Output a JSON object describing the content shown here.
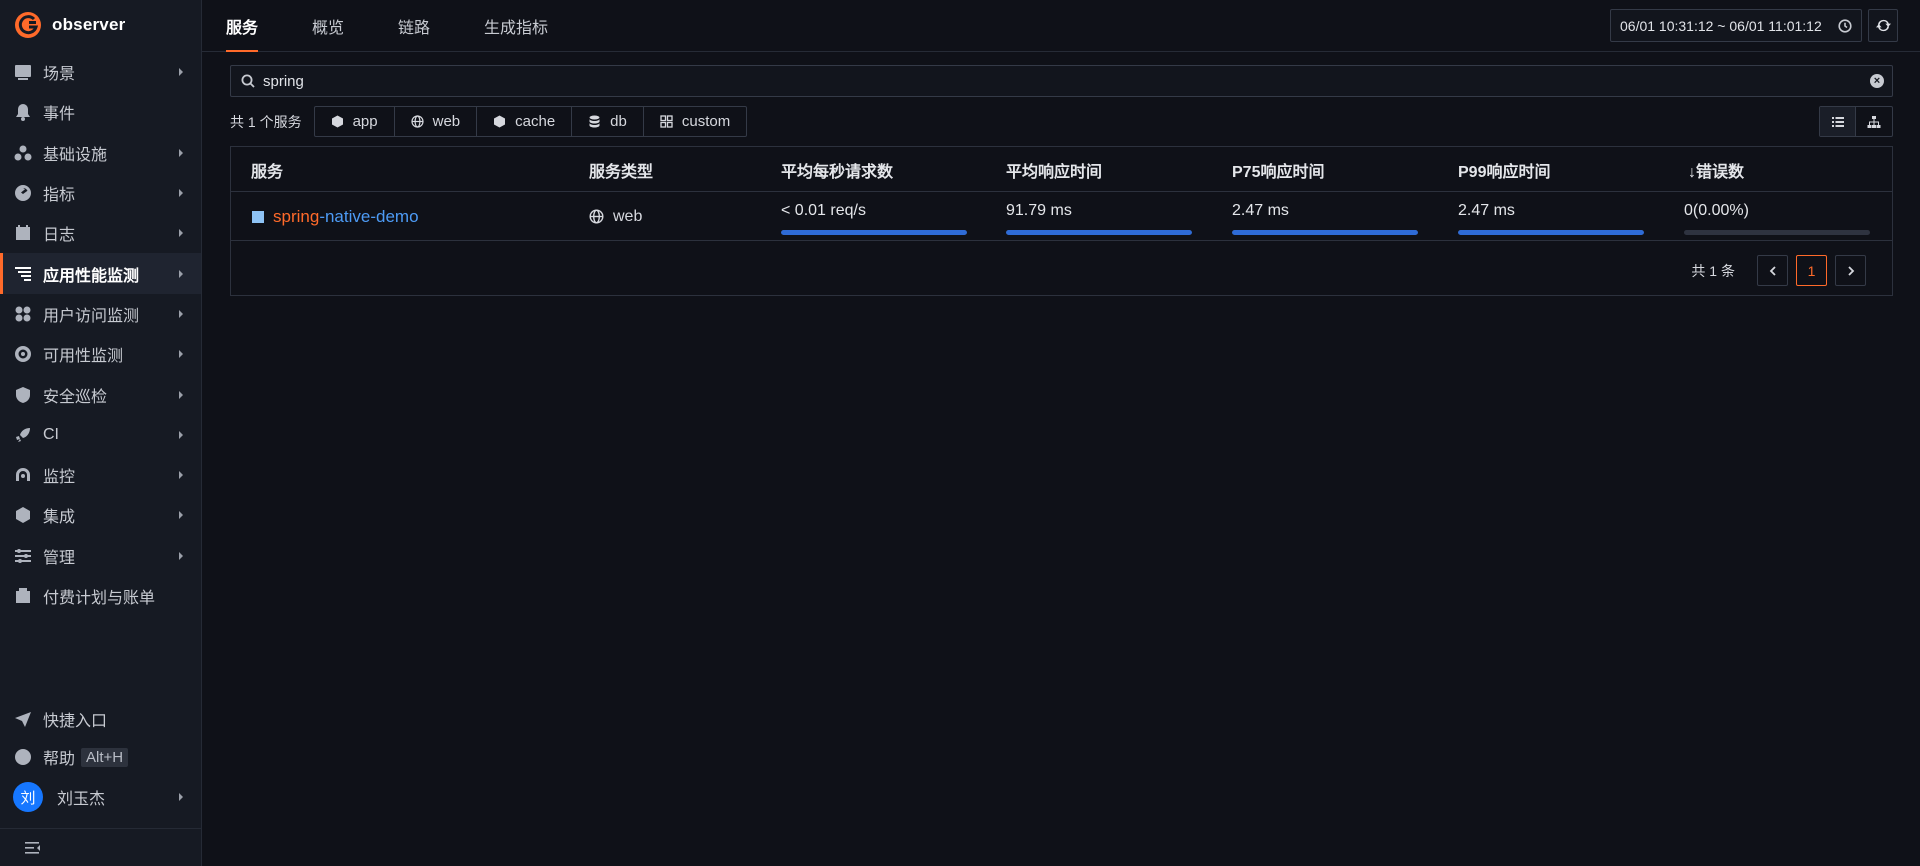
{
  "app": {
    "name": "observer",
    "brand_color": "#ff6a2a"
  },
  "sidebar": {
    "items": [
      {
        "label": "场景",
        "icon": "dashboard-icon",
        "arrow": true
      },
      {
        "label": "事件",
        "icon": "bell-icon",
        "arrow": false
      },
      {
        "label": "基础设施",
        "icon": "infrastructure-icon",
        "arrow": true
      },
      {
        "label": "指标",
        "icon": "metrics-gauge-icon",
        "arrow": true
      },
      {
        "label": "日志",
        "icon": "log-icon",
        "arrow": true
      },
      {
        "label": "应用性能监测",
        "icon": "apm-icon",
        "arrow": true,
        "active": true
      },
      {
        "label": "用户访问监测",
        "icon": "rum-icon",
        "arrow": true
      },
      {
        "label": "可用性监测",
        "icon": "availability-icon",
        "arrow": true
      },
      {
        "label": "安全巡检",
        "icon": "shield-icon",
        "arrow": true
      },
      {
        "label": "CI",
        "icon": "rocket-icon",
        "arrow": true
      },
      {
        "label": "监控",
        "icon": "monitor-icon",
        "arrow": true
      },
      {
        "label": "集成",
        "icon": "integration-cube-icon",
        "arrow": true
      },
      {
        "label": "管理",
        "icon": "settings-sliders-icon",
        "arrow": true
      },
      {
        "label": "付费计划与账单",
        "icon": "billing-icon",
        "arrow": false
      }
    ],
    "quick_entry": "快捷入口",
    "help": "帮助",
    "help_shortcut": "Alt+H",
    "user": {
      "avatar_text": "刘",
      "name": "刘玉杰"
    }
  },
  "tabs": [
    "服务",
    "概览",
    "链路",
    "生成指标"
  ],
  "time_range": "06/01 10:31:12 ~ 06/01 11:01:12",
  "search": {
    "value": "spring",
    "placeholder": ""
  },
  "filters": {
    "count_label": "共 1 个服务",
    "chips": [
      {
        "label": "app",
        "icon": "app-cube-icon"
      },
      {
        "label": "web",
        "icon": "globe-icon"
      },
      {
        "label": "cache",
        "icon": "cache-icon"
      },
      {
        "label": "db",
        "icon": "database-icon"
      },
      {
        "label": "custom",
        "icon": "custom-grid-icon"
      }
    ]
  },
  "table": {
    "headers": [
      "服务",
      "服务类型",
      "平均每秒请求数",
      "平均响应时间",
      "P75响应时间",
      "P99响应时间",
      "↓错误数"
    ],
    "rows": [
      {
        "service_highlight": "spring",
        "service_rest": "-native-demo",
        "type": "web",
        "rps": "< 0.01 req/s",
        "rps_bar": 1.0,
        "avg_resp": "91.79 ms",
        "avg_resp_bar": 1.0,
        "p75": "2.47 ms",
        "p75_bar": 1.0,
        "p99": "2.47 ms",
        "p99_bar": 1.0,
        "errors": "0(0.00%)",
        "errors_bar": 0.0
      }
    ]
  },
  "pagination": {
    "total": "共 1 条",
    "current": "1"
  }
}
